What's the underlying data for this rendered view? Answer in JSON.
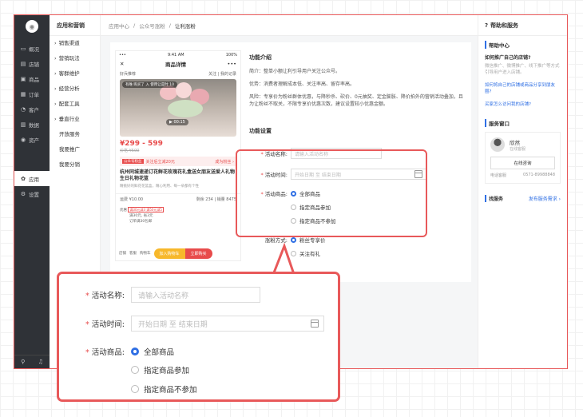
{
  "sidebar": {
    "items": [
      {
        "icon": "overview-icon",
        "glyph": "▭",
        "label": "概况"
      },
      {
        "icon": "store-icon",
        "glyph": "▤",
        "label": "店铺"
      },
      {
        "icon": "goods-icon",
        "glyph": "▣",
        "label": "商品"
      },
      {
        "icon": "order-icon",
        "glyph": "▦",
        "label": "订单"
      },
      {
        "icon": "customer-icon",
        "glyph": "◔",
        "label": "客户"
      },
      {
        "icon": "data-icon",
        "glyph": "▥",
        "label": "数据"
      },
      {
        "icon": "assets-icon",
        "glyph": "◉",
        "label": "资产"
      },
      {
        "icon": "apps-icon",
        "glyph": "✿",
        "label": "应用"
      },
      {
        "icon": "settings-icon",
        "glyph": "⚙",
        "label": "设置"
      }
    ]
  },
  "nav2": {
    "title": "应用和营销",
    "items": [
      {
        "label": "销售渠道",
        "arrow": "›"
      },
      {
        "label": "营销玩法",
        "arrow": "›"
      },
      {
        "label": "客群维护",
        "arrow": "›"
      },
      {
        "label": "经营分析",
        "arrow": "›"
      },
      {
        "label": "配套工具",
        "arrow": "›"
      },
      {
        "label": "垂直行业",
        "arrow": "›"
      },
      {
        "label": "开放服务",
        "arrow": ""
      },
      {
        "label": "我要推广",
        "arrow": ""
      },
      {
        "label": "我要分销",
        "arrow": ""
      }
    ]
  },
  "breadcrumb": {
    "b1": "应用中心",
    "b2": "公众号涨粉",
    "b3": "让利涨粉",
    "sep": "/"
  },
  "phone": {
    "time": "9:41 AM",
    "battery": "100%",
    "title": "商品详情",
    "shop": "好兵推荐",
    "follow": "关注",
    "records": "我的记录",
    "banner": "有唯 购买了 入 使用让是时 10",
    "duration": "00:15",
    "price": "¥299 - 599",
    "old_price": "价格 ¥500",
    "coupon_tag": "公众号粉丝",
    "coupon_text": "关注后立减20元",
    "coupon_cta": "成为粉丝 ›",
    "title_text": "杭州同城速递订花鲜花玫瑰花礼盒送女朋友送爱人礼物生日礼物花篮",
    "desc": "精挑好的鲜花花篮盒，精心利用、每一朵都有个性",
    "row_left": "运费  ¥10.00",
    "row_right": "剩余 234  | 销量 8475",
    "promo1": "满30元减3 满50元减5",
    "promo2": "满30元, 省3元",
    "promo3": "订单满30包邮",
    "promo_label": "优惠",
    "bottom_store": "店铺",
    "bottom_service": "客服",
    "bottom_cart": "购物车",
    "btn_cart": "加入购物车",
    "btn_buy": "立即购买"
  },
  "intro": {
    "title": "功能介绍",
    "p1": "简介：整单小额让利引导用户关注公众号。",
    "p2": "优势：消费者理解成本低、关注率高、留存率高。",
    "p3": "风险：专享价为粉丝群体优惠，与降秒杀、砍价、0元抽奖、定金膨胀、降价拍外的营销活动叠加，且为让粉丝不取关，不限专享价优惠次数，建议设置较小优惠金额。"
  },
  "form": {
    "title": "功能设置",
    "name_label": "活动名称:",
    "name_placeholder": "请输入活动名称",
    "time_label": "活动时间:",
    "start_placeholder": "开始日期",
    "to": "至",
    "end_placeholder": "结束日期",
    "goods_label": "活动商品:",
    "opt_all": "全部商品",
    "opt_include": "指定商品参加",
    "opt_exclude": "指定商品不参加",
    "fan_label": "涨粉方式:",
    "fan_opt1": "粉丝专享价",
    "fan_opt2": "关注有礼",
    "required": "*"
  },
  "right_panel": {
    "header": "帮助和服务",
    "help_title": "帮助中心",
    "q1": "如何推广自己的店铺?",
    "a1": "微信推广、微博推广、线下推广等方式引导用户进入店铺。",
    "link1": "如何将自己的店铺或商品分享到朋友圈?",
    "link2": "买家怎么访问我的店铺?",
    "window_title": "服务窗口",
    "agent_name": "欣然",
    "agent_role": "在线客服",
    "consult_btn": "在线咨询",
    "tel_label": "电话客服",
    "tel": "0571-89988848",
    "find_label": "找服务",
    "publish_link": "发布服务需求 ›"
  }
}
